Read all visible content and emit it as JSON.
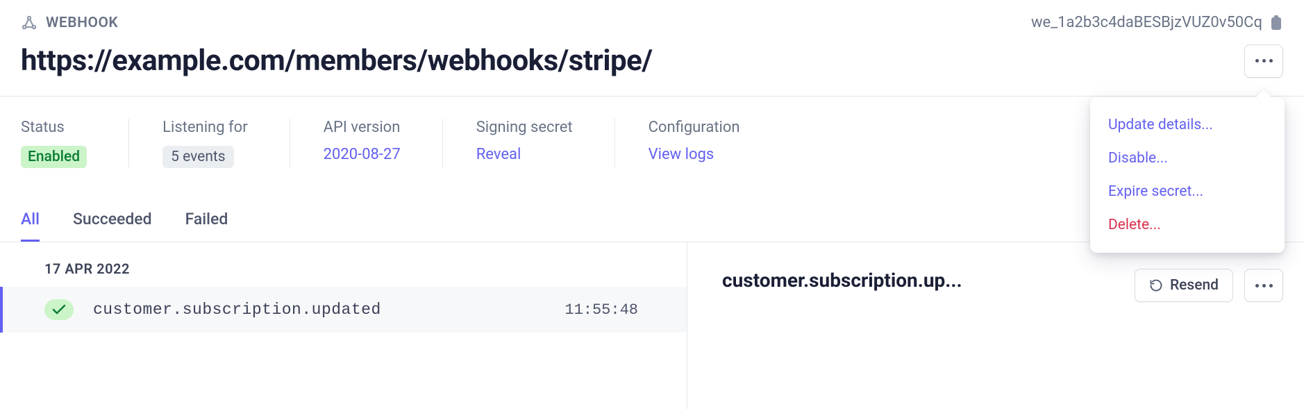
{
  "header": {
    "breadcrumb": "WEBHOOK",
    "webhook_id": "we_1a2b3c4daBESBjzVUZ0v50Cq",
    "title": "https://example.com/members/webhooks/stripe/"
  },
  "meta": {
    "status": {
      "label": "Status",
      "value": "Enabled"
    },
    "listening": {
      "label": "Listening for",
      "value": "5 events"
    },
    "api_version": {
      "label": "API version",
      "value": "2020-08-27"
    },
    "signing_secret": {
      "label": "Signing secret",
      "value": "Reveal"
    },
    "configuration": {
      "label": "Configuration",
      "value": "View logs"
    }
  },
  "tabs": {
    "all": "All",
    "succeeded": "Succeeded",
    "failed": "Failed"
  },
  "events": {
    "date_header": "17 APR 2022",
    "row": {
      "name": "customer.subscription.updated",
      "time": "11:55:48"
    }
  },
  "detail": {
    "title": "customer.subscription.up...",
    "resend_label": "Resend"
  },
  "dropdown": {
    "update": "Update details...",
    "disable": "Disable...",
    "expire": "Expire secret...",
    "delete": "Delete..."
  }
}
